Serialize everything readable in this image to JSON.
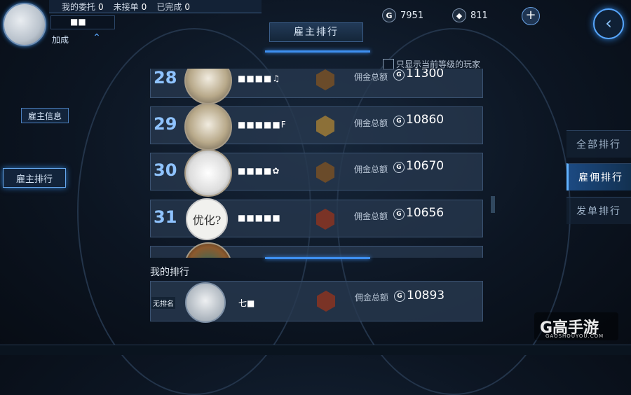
{
  "header": {
    "stats": [
      {
        "label": "我的委托",
        "value": "0"
      },
      {
        "label": "未接单",
        "value": "0"
      },
      {
        "label": "已完成",
        "value": "0"
      }
    ],
    "player_name": "■■",
    "bonus_label": "加成",
    "currency": {
      "gold": "7951",
      "gem": "811",
      "gold_icon": "G"
    },
    "page_title": "雇主排行"
  },
  "left_menu": {
    "employer_info": "雇主信息",
    "employer_rank": "雇主排行"
  },
  "filter": {
    "label": "只显示当前等级的玩家",
    "checked": false
  },
  "rows": [
    {
      "rank": "28",
      "name": "■■■■♫",
      "label": "佣金总额",
      "amount": "11300",
      "pic_text": ""
    },
    {
      "rank": "29",
      "name": "■■■■■F",
      "label": "佣金总额",
      "amount": "10860",
      "pic_text": ""
    },
    {
      "rank": "30",
      "name": "■■■■✿",
      "label": "佣金总额",
      "amount": "10670",
      "pic_text": ""
    },
    {
      "rank": "31",
      "name": "■■■■■",
      "label": "佣金总额",
      "amount": "10656",
      "pic_text": "优化?"
    }
  ],
  "my_rank": {
    "title": "我的排行",
    "rank_label": "无排名",
    "name": "七■",
    "label": "佣金总额",
    "amount": "10893"
  },
  "right_tabs": {
    "all": "全部排行",
    "hire": "雇佣排行",
    "issue": "发单排行"
  },
  "watermark": {
    "logo": "G高手游",
    "sub": "GAOSHOUYOU.COM"
  }
}
